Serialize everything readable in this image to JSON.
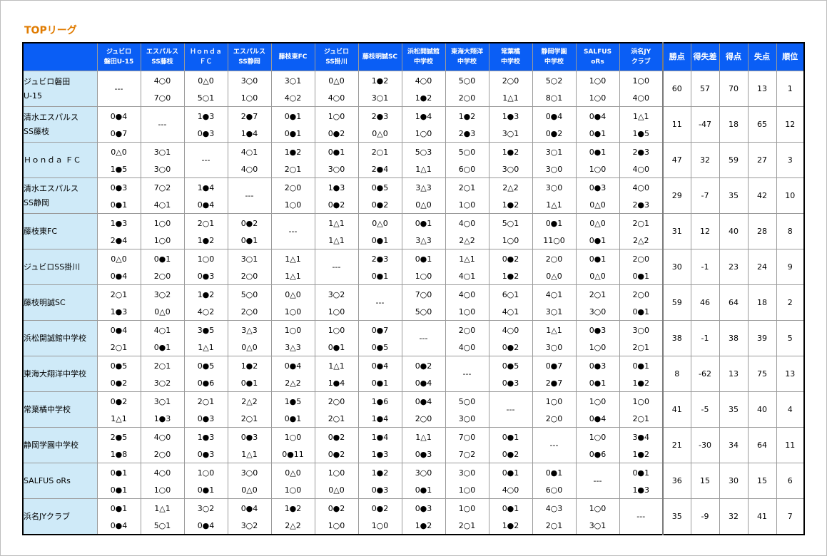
{
  "title": "TOPリーグ",
  "columns": [
    {
      "l1": "ジュビロ",
      "l2": "磐田U-15"
    },
    {
      "l1": "エスパルス",
      "l2": "SS藤枝"
    },
    {
      "l1": "Ｈｏｎｄａ",
      "l2": "ＦＣ"
    },
    {
      "l1": "エスパルス",
      "l2": "SS静岡"
    },
    {
      "l1": "藤枝東FC",
      "l2": ""
    },
    {
      "l1": "ジュビロ",
      "l2": "SS掛川"
    },
    {
      "l1": "藤枝明誠SC",
      "l2": ""
    },
    {
      "l1": "浜松開誠館",
      "l2": "中学校"
    },
    {
      "l1": "東海大翔洋",
      "l2": "中学校"
    },
    {
      "l1": "常葉橘",
      "l2": "中学校"
    },
    {
      "l1": "静岡学園",
      "l2": "中学校"
    },
    {
      "l1": "SALFUS",
      "l2": "oRs"
    },
    {
      "l1": "浜名JY",
      "l2": "クラブ"
    }
  ],
  "stat_headers": [
    "勝点",
    "得失差",
    "得点",
    "失点",
    "順位"
  ],
  "self_mark": "---",
  "rows": [
    {
      "l1": "ジュビロ磐田",
      "l2": "U-15",
      "self": 0,
      "results": [
        null,
        [
          "4○0",
          "7○0"
        ],
        [
          "0△0",
          "5○1"
        ],
        [
          "3○0",
          "1○0"
        ],
        [
          "3○1",
          "4○2"
        ],
        [
          "0△0",
          "4○0"
        ],
        [
          "1●2",
          "3○1"
        ],
        [
          "4○0",
          "1●2"
        ],
        [
          "5○0",
          "2○0"
        ],
        [
          "2○0",
          "1△1"
        ],
        [
          "5○2",
          "8○1"
        ],
        [
          "1○0",
          "1○0"
        ],
        [
          "1○0",
          "4○0"
        ]
      ],
      "stats": [
        "60",
        "57",
        "70",
        "13",
        "1"
      ]
    },
    {
      "l1": "清水エスパルス",
      "l2": "SS藤枝",
      "self": 1,
      "results": [
        [
          "0●4",
          "0●7"
        ],
        null,
        [
          "1●3",
          "0●3"
        ],
        [
          "2●7",
          "1●4"
        ],
        [
          "0●1",
          "0●1"
        ],
        [
          "1○0",
          "0●2"
        ],
        [
          "2●3",
          "0△0"
        ],
        [
          "1●4",
          "1○0"
        ],
        [
          "1●2",
          "2●3"
        ],
        [
          "1●3",
          "3○1"
        ],
        [
          "0●4",
          "0●2"
        ],
        [
          "0●4",
          "0●1"
        ],
        [
          "1△1",
          "1●5"
        ]
      ],
      "stats": [
        "11",
        "-47",
        "18",
        "65",
        "12"
      ]
    },
    {
      "l1": "Ｈｏｎｄａ ＦＣ",
      "l2": "",
      "self": 2,
      "results": [
        [
          "0△0",
          "1●5"
        ],
        [
          "3○1",
          "3○0"
        ],
        null,
        [
          "4○1",
          "4○0"
        ],
        [
          "1●2",
          "2○1"
        ],
        [
          "0●1",
          "3○0"
        ],
        [
          "2○1",
          "2●4"
        ],
        [
          "5○3",
          "1△1"
        ],
        [
          "5○0",
          "6○0"
        ],
        [
          "1●2",
          "3○0"
        ],
        [
          "3○1",
          "3○0"
        ],
        [
          "0●1",
          "1○0"
        ],
        [
          "2●3",
          "4○0"
        ]
      ],
      "stats": [
        "47",
        "32",
        "59",
        "27",
        "3"
      ]
    },
    {
      "l1": "清水エスパルス",
      "l2": "SS静岡",
      "self": 3,
      "results": [
        [
          "0●3",
          "0●1"
        ],
        [
          "7○2",
          "4○1"
        ],
        [
          "1●4",
          "0●4"
        ],
        null,
        [
          "2○0",
          "1○0"
        ],
        [
          "1●3",
          "0●2"
        ],
        [
          "0●5",
          "0●2"
        ],
        [
          "3△3",
          "0△0"
        ],
        [
          "2○1",
          "1○0"
        ],
        [
          "2△2",
          "1●2"
        ],
        [
          "3○0",
          "1△1"
        ],
        [
          "0●3",
          "0△0"
        ],
        [
          "4○0",
          "2●3"
        ]
      ],
      "stats": [
        "29",
        "-7",
        "35",
        "42",
        "10"
      ]
    },
    {
      "l1": "藤枝東FC",
      "l2": "",
      "self": 4,
      "results": [
        [
          "1●3",
          "2●4"
        ],
        [
          "1○0",
          "1○0"
        ],
        [
          "2○1",
          "1●2"
        ],
        [
          "0●2",
          "0●1"
        ],
        null,
        [
          "1△1",
          "1△1"
        ],
        [
          "0△0",
          "0●1"
        ],
        [
          "0●1",
          "3△3"
        ],
        [
          "4○0",
          "2△2"
        ],
        [
          "5○1",
          "1○0"
        ],
        [
          "0●1",
          "11○0"
        ],
        [
          "0△0",
          "0●1"
        ],
        [
          "2○1",
          "2△2"
        ]
      ],
      "stats": [
        "31",
        "12",
        "40",
        "28",
        "8"
      ]
    },
    {
      "l1": "ジュビロSS掛川",
      "l2": "",
      "self": 5,
      "results": [
        [
          "0△0",
          "0●4"
        ],
        [
          "0●1",
          "2○0"
        ],
        [
          "1○0",
          "0●3"
        ],
        [
          "3○1",
          "2○0"
        ],
        [
          "1△1",
          "1△1"
        ],
        null,
        [
          "2●3",
          "0●1"
        ],
        [
          "0●1",
          "1○0"
        ],
        [
          "1△1",
          "4○1"
        ],
        [
          "0●2",
          "1●2"
        ],
        [
          "2○0",
          "0△0"
        ],
        [
          "0●1",
          "0△0"
        ],
        [
          "2○0",
          "0●1"
        ]
      ],
      "stats": [
        "30",
        "-1",
        "23",
        "24",
        "9"
      ]
    },
    {
      "l1": "藤枝明誠SC",
      "l2": "",
      "self": 6,
      "results": [
        [
          "2○1",
          "1●3"
        ],
        [
          "3○2",
          "0△0"
        ],
        [
          "1●2",
          "4○2"
        ],
        [
          "5○0",
          "2○0"
        ],
        [
          "0△0",
          "1○0"
        ],
        [
          "3○2",
          "1○0"
        ],
        null,
        [
          "7○0",
          "5○0"
        ],
        [
          "4○0",
          "1○0"
        ],
        [
          "6○1",
          "4○1"
        ],
        [
          "4○1",
          "3○1"
        ],
        [
          "2○1",
          "3○0"
        ],
        [
          "2○0",
          "0●1"
        ]
      ],
      "stats": [
        "59",
        "46",
        "64",
        "18",
        "2"
      ]
    },
    {
      "l1": "浜松開誠館中学校",
      "l2": "",
      "self": 7,
      "results": [
        [
          "0●4",
          "2○1"
        ],
        [
          "4○1",
          "0●1"
        ],
        [
          "3●5",
          "1△1"
        ],
        [
          "3△3",
          "0△0"
        ],
        [
          "1○0",
          "3△3"
        ],
        [
          "1○0",
          "0●1"
        ],
        [
          "0●7",
          "0●5"
        ],
        null,
        [
          "2○0",
          "4○0"
        ],
        [
          "4○0",
          "0●2"
        ],
        [
          "1△1",
          "3○0"
        ],
        [
          "0●3",
          "1○0"
        ],
        [
          "3○0",
          "2○1"
        ]
      ],
      "stats": [
        "38",
        "-1",
        "38",
        "39",
        "5"
      ]
    },
    {
      "l1": "東海大翔洋中学校",
      "l2": "",
      "self": 8,
      "results": [
        [
          "0●5",
          "0●2"
        ],
        [
          "2○1",
          "3○2"
        ],
        [
          "0●5",
          "0●6"
        ],
        [
          "1●2",
          "0●1"
        ],
        [
          "0●4",
          "2△2"
        ],
        [
          "1△1",
          "1●4"
        ],
        [
          "0●4",
          "0●1"
        ],
        [
          "0●2",
          "0●4"
        ],
        null,
        [
          "0●5",
          "0●3"
        ],
        [
          "0●7",
          "2●7"
        ],
        [
          "0●3",
          "0●1"
        ],
        [
          "0●1",
          "1●2"
        ]
      ],
      "stats": [
        "8",
        "-62",
        "13",
        "75",
        "13"
      ]
    },
    {
      "l1": "常葉橘中学校",
      "l2": "",
      "self": 9,
      "results": [
        [
          "0●2",
          "1△1"
        ],
        [
          "3○1",
          "1●3"
        ],
        [
          "2○1",
          "0●3"
        ],
        [
          "2△2",
          "2○1"
        ],
        [
          "1●5",
          "0●1"
        ],
        [
          "2○0",
          "2○1"
        ],
        [
          "1●6",
          "1●4"
        ],
        [
          "0●4",
          "2○0"
        ],
        [
          "5○0",
          "3○0"
        ],
        null,
        [
          "1○0",
          "2○0"
        ],
        [
          "1○0",
          "0●4"
        ],
        [
          "1○0",
          "2○1"
        ]
      ],
      "stats": [
        "41",
        "-5",
        "35",
        "40",
        "4"
      ]
    },
    {
      "l1": "静岡学園中学校",
      "l2": "",
      "self": 10,
      "results": [
        [
          "2●5",
          "1●8"
        ],
        [
          "4○0",
          "2○0"
        ],
        [
          "1●3",
          "0●3"
        ],
        [
          "0●3",
          "1△1"
        ],
        [
          "1○0",
          "0●11"
        ],
        [
          "0●2",
          "0●2"
        ],
        [
          "1●4",
          "1●3"
        ],
        [
          "1△1",
          "0●3"
        ],
        [
          "7○0",
          "7○2"
        ],
        [
          "0●1",
          "0●2"
        ],
        null,
        [
          "1○0",
          "0●6"
        ],
        [
          "3●4",
          "1●2"
        ]
      ],
      "stats": [
        "21",
        "-30",
        "34",
        "64",
        "11"
      ]
    },
    {
      "l1": "SALFUS oRs",
      "l2": "",
      "self": 11,
      "results": [
        [
          "0●1",
          "0●1"
        ],
        [
          "4○0",
          "1○0"
        ],
        [
          "1○0",
          "0●1"
        ],
        [
          "3○0",
          "0△0"
        ],
        [
          "0△0",
          "1○0"
        ],
        [
          "1○0",
          "0△0"
        ],
        [
          "1●2",
          "0●3"
        ],
        [
          "3○0",
          "0●1"
        ],
        [
          "3○0",
          "1○0"
        ],
        [
          "0●1",
          "4○0"
        ],
        [
          "0●1",
          "6○0"
        ],
        null,
        [
          "0●1",
          "1●3"
        ]
      ],
      "stats": [
        "36",
        "15",
        "30",
        "15",
        "6"
      ]
    },
    {
      "l1": "浜名JYクラブ",
      "l2": "",
      "self": 12,
      "results": [
        [
          "0●1",
          "0●4"
        ],
        [
          "1△1",
          "5○1"
        ],
        [
          "3○2",
          "0●4"
        ],
        [
          "0●4",
          "3○2"
        ],
        [
          "1●2",
          "2△2"
        ],
        [
          "0●2",
          "1○0"
        ],
        [
          "0●2",
          "1○0"
        ],
        [
          "0●3",
          "1●2"
        ],
        [
          "1○0",
          "2○1"
        ],
        [
          "0●1",
          "1●2"
        ],
        [
          "4○3",
          "2○1"
        ],
        [
          "1○0",
          "3○1"
        ],
        null
      ],
      "stats": [
        "35",
        "-9",
        "32",
        "41",
        "7"
      ]
    }
  ]
}
